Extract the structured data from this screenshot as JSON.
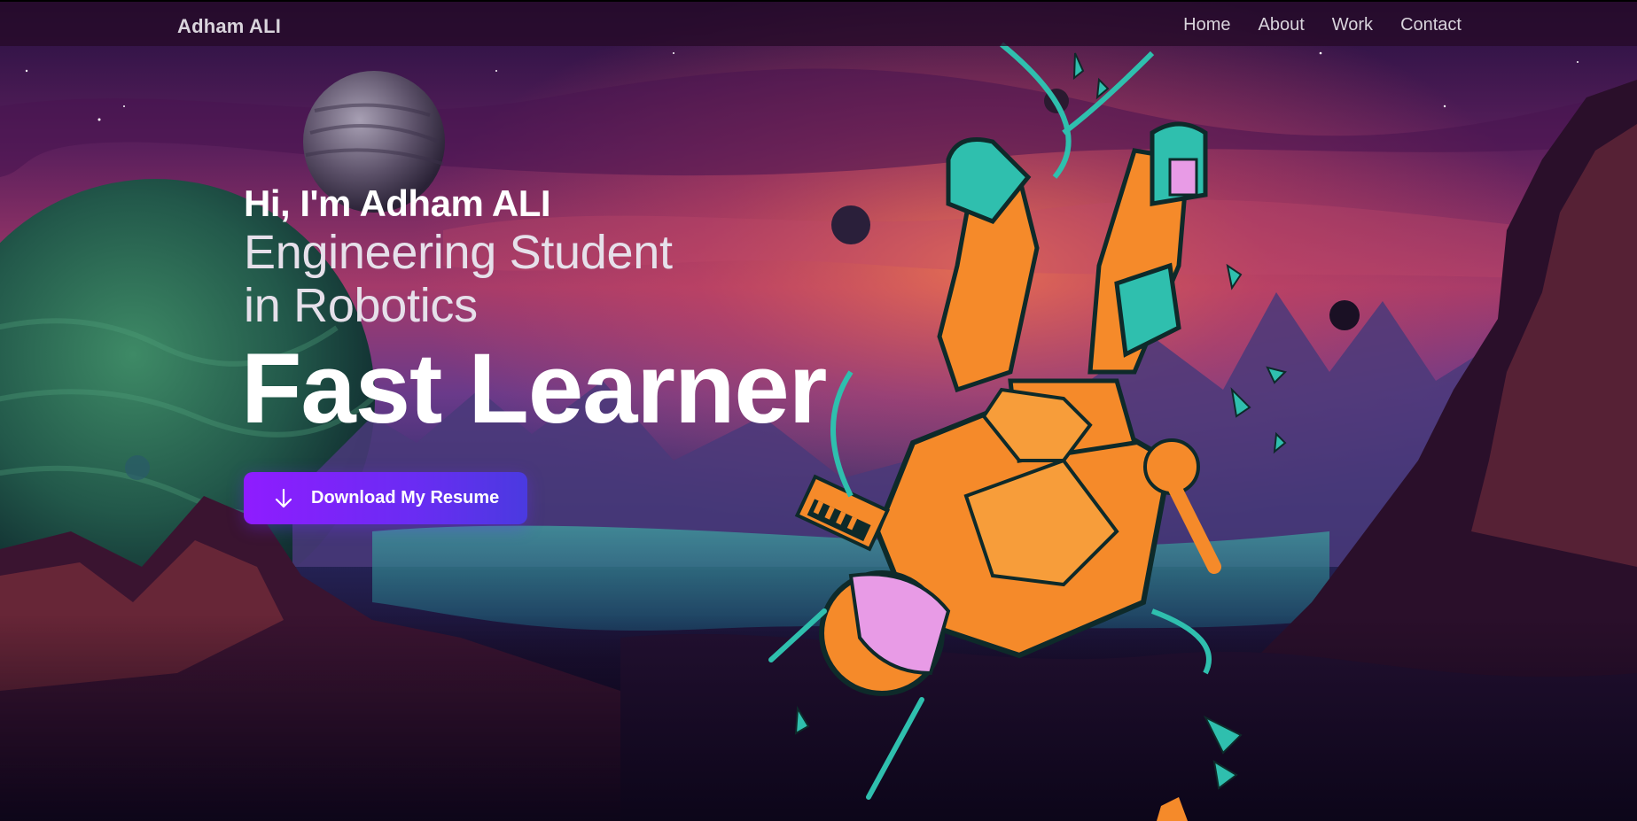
{
  "navbar": {
    "brand": "Adham ALI",
    "links": [
      {
        "label": "Home"
      },
      {
        "label": "About"
      },
      {
        "label": "Work"
      },
      {
        "label": "Contact"
      }
    ]
  },
  "hero": {
    "greeting": "Hi, I'm Adham ALI",
    "subtitle_line1": "Engineering Student",
    "subtitle_line2": "in Robotics",
    "headline": "Fast Learner",
    "cta_label": "Download My Resume",
    "cta_icon": "arrow-down-icon"
  },
  "background": {
    "description_icon": "space-astronaut-illustration",
    "colors": {
      "sky_top": "#2a1048",
      "sky_mid": "#8a2f6a",
      "sky_glow": "#e0644e",
      "ground": "#0b0518",
      "planet_green": "#2f7a5a",
      "astronaut_orange": "#f58a2a",
      "astronaut_teal": "#2fbfae",
      "accent": "#8f1cff"
    }
  }
}
